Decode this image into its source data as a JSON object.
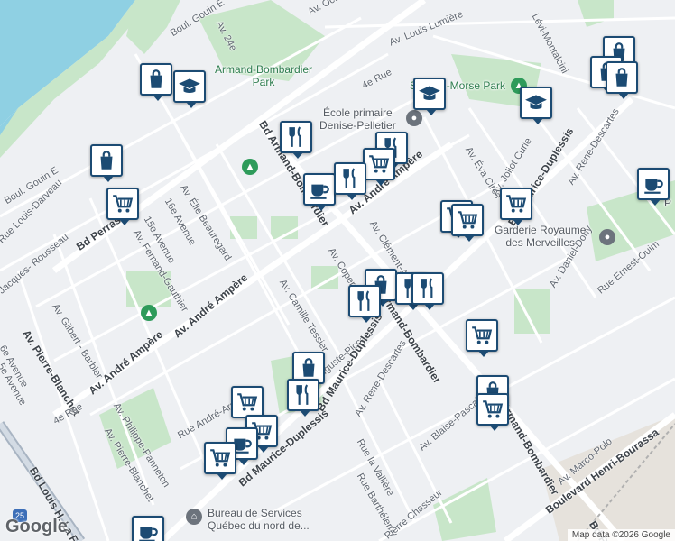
{
  "map": {
    "attribution": "Map data ©2026 Google",
    "logo": "Google",
    "colors": {
      "background": "#eef0f3",
      "water": "#8fd0e3",
      "park": "#c8e6c9",
      "road": "#ffffff",
      "marker_border": "#1c4b73"
    }
  },
  "streets": [
    {
      "id": "av-octave",
      "text": "Av. Octa"
    },
    {
      "id": "av-24e",
      "text": "Av. 24e"
    },
    {
      "id": "boul-gouin-e-top",
      "text": "Boul. Gouin E"
    },
    {
      "id": "av-louis-lumiere",
      "text": "Av. Louis Lumière"
    },
    {
      "id": "levi-montalcini",
      "text": "Lévi-Montalcini"
    },
    {
      "id": "4e-rue-top",
      "text": "4e Rue"
    },
    {
      "id": "bd-armand-bombardier-top",
      "text": "Bd Armand-Bombardier"
    },
    {
      "id": "boul-gouin-e-left",
      "text": "Boul. Gouin E"
    },
    {
      "id": "rue-louis-darveau",
      "text": "Rue Louis-Darveau"
    },
    {
      "id": "av-elie-beauregard",
      "text": "Av. Élie Beauregard"
    },
    {
      "id": "16e-avenue",
      "text": "16e Avenue"
    },
    {
      "id": "15e-avenue",
      "text": "15e Avenue"
    },
    {
      "id": "av-fernand-gauthier",
      "text": "Av. Fernand-Gauthier"
    },
    {
      "id": "bd-perras",
      "text": "Bd Perras"
    },
    {
      "id": "jacques-rousseau",
      "text": "Jacques- Rousseau"
    },
    {
      "id": "av-gilbert-barbier",
      "text": "Av. Gilbert - Barbier"
    },
    {
      "id": "av-pierre-blanchet",
      "text": "Av. Pierre-Blanchet"
    },
    {
      "id": "6e-avenue",
      "text": "6e Avenue"
    },
    {
      "id": "5e-avenue",
      "text": "5e Avenue"
    },
    {
      "id": "av-andre-ampere-left",
      "text": "Av. André Ampère"
    },
    {
      "id": "av-andre-ampere-mid",
      "text": "Av. André Ampère"
    },
    {
      "id": "av-andre-ampere-right",
      "text": "Av. André Ampère"
    },
    {
      "id": "av-philippe-panneton",
      "text": "Av. Philippe-Panneton"
    },
    {
      "id": "4e-rue-bottom",
      "text": "4e Rue"
    },
    {
      "id": "av-pierre-blanchet-bottom",
      "text": "Av. Pierre-Blanchet"
    },
    {
      "id": "bd-louis-h-la-fontaine",
      "text": "Bd Louis H. La Fo"
    },
    {
      "id": "rue-andre-arnoux",
      "text": "Rue André-Arnoux"
    },
    {
      "id": "av-camille-tessier",
      "text": "Av. Camille Tessier"
    },
    {
      "id": "av-copernic",
      "text": "Av. Copernic"
    },
    {
      "id": "auguste-piccard",
      "text": "Auguste-Piccard"
    },
    {
      "id": "bd-maurice-duplessis-bottom",
      "text": "Bd Maurice-Duplessis"
    },
    {
      "id": "bd-maurice-duplessis-mid",
      "text": "Bd Maurice-Duplessis"
    },
    {
      "id": "bd-maurice-duplessis-right",
      "text": "Bd Maurice-Duplessis"
    },
    {
      "id": "av-rene-descartes-bottom",
      "text": "Av. René-Descartes"
    },
    {
      "id": "av-rene-descartes-right",
      "text": "Av. René-Descartes"
    },
    {
      "id": "bd-armand-bombardier-mid",
      "text": "Bd Armand-Bombardier"
    },
    {
      "id": "armand-bombardier-bottom",
      "text": "Armand-Bombardier"
    },
    {
      "id": "av-clement-ader",
      "text": "Av. Clément-Ader"
    },
    {
      "id": "av-eva-circe",
      "text": "Av. Éva Circé"
    },
    {
      "id": "av-joliot-curie",
      "text": "Av. Joliot Curie"
    },
    {
      "id": "rue-la-valliere",
      "text": "Rue la Vallière"
    },
    {
      "id": "rue-barthelemy",
      "text": "Rue Barthélemy"
    },
    {
      "id": "pierre-chasseur",
      "text": "Pierre Chasseur"
    },
    {
      "id": "av-blaise-pascal",
      "text": "Av. Blaise-Pascal"
    },
    {
      "id": "av-marco-polo",
      "text": "Av. Marco-Polo"
    },
    {
      "id": "boulevard-henri-bourassa",
      "text": "Boulevard Henri-Bourassa"
    },
    {
      "id": "av-daniel-dony",
      "text": "Av. Daniel-Dony"
    },
    {
      "id": "rue-ernest-ouimet",
      "text": "Rue Ernest-Ouim"
    },
    {
      "id": "bd-r-bottom",
      "text": "Bd R"
    }
  ],
  "pois": [
    {
      "id": "armand-bombardier-park",
      "text": "Armand-Bombardier\nPark",
      "kind": "park"
    },
    {
      "id": "samuel-morse-park",
      "text": "Samuel-Morse Park",
      "kind": "park"
    },
    {
      "id": "ecole-primaire",
      "text": "École primaire\nDenise-Pelletier",
      "kind": "school"
    },
    {
      "id": "garderie-royaume",
      "text": "Garderie Royaume\ndes Merveilles",
      "kind": "daycare"
    },
    {
      "id": "bureau-services-quebec",
      "text": "Bureau de Services\nQuébec du nord de...",
      "kind": "gov"
    },
    {
      "id": "cafe-label-p",
      "text": "P",
      "kind": "gov"
    }
  ],
  "markers": [
    {
      "id": "m1",
      "icon": "shopping-bag-icon"
    },
    {
      "id": "m2",
      "icon": "shopping-bag-icon"
    },
    {
      "id": "m3",
      "icon": "shopping-bag-icon"
    },
    {
      "id": "m4",
      "icon": "school-icon"
    },
    {
      "id": "m5",
      "icon": "school-icon"
    },
    {
      "id": "m6",
      "icon": "school-icon"
    },
    {
      "id": "m7",
      "icon": "restaurant-icon"
    },
    {
      "id": "m8",
      "icon": "restaurant-icon"
    },
    {
      "id": "m9",
      "icon": "shopping-cart-icon"
    },
    {
      "id": "m10",
      "icon": "coffee-icon"
    },
    {
      "id": "m11",
      "icon": "restaurant-icon"
    },
    {
      "id": "m12",
      "icon": "shopping-cart-icon"
    },
    {
      "id": "m13",
      "icon": "shopping-cart-icon"
    },
    {
      "id": "m14",
      "icon": "shopping-cart-icon"
    },
    {
      "id": "m15",
      "icon": "shopping-cart-icon"
    },
    {
      "id": "m16",
      "icon": "coffee-icon"
    },
    {
      "id": "m17",
      "icon": "shopping-bag-icon"
    },
    {
      "id": "m18",
      "icon": "restaurant-icon"
    },
    {
      "id": "m19",
      "icon": "restaurant-icon"
    },
    {
      "id": "m20",
      "icon": "restaurant-icon"
    },
    {
      "id": "m21",
      "icon": "shopping-cart-icon"
    },
    {
      "id": "m22",
      "icon": "shopping-bag-icon"
    },
    {
      "id": "m23",
      "icon": "restaurant-icon"
    },
    {
      "id": "m24",
      "icon": "shopping-cart-icon"
    },
    {
      "id": "m25",
      "icon": "shopping-bag-icon"
    },
    {
      "id": "m26",
      "icon": "shopping-cart-icon"
    },
    {
      "id": "m27",
      "icon": "shopping-cart-icon"
    },
    {
      "id": "m28",
      "icon": "coffee-icon"
    },
    {
      "id": "m29",
      "icon": "shopping-cart-icon"
    },
    {
      "id": "m30",
      "icon": "coffee-icon"
    },
    {
      "id": "m31",
      "icon": "shopping-bag-icon"
    },
    {
      "id": "m32",
      "icon": "shopping-bag-icon"
    }
  ]
}
